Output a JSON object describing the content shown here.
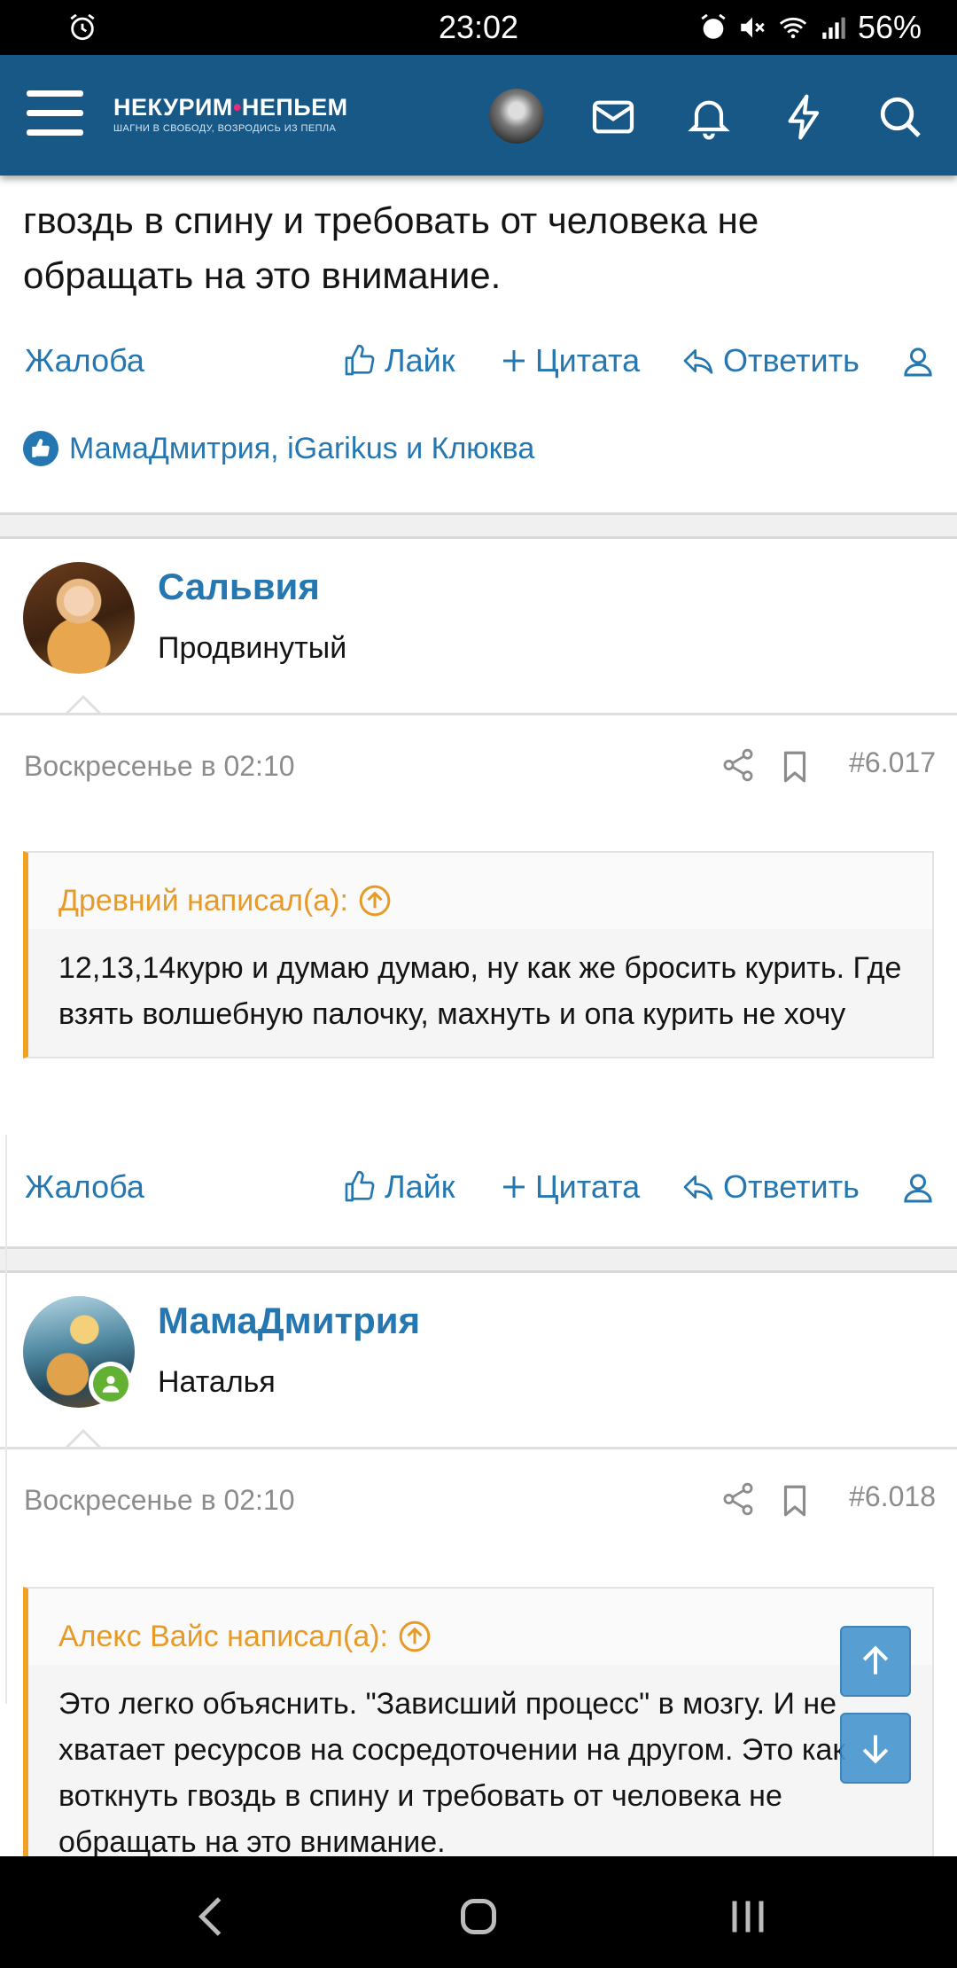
{
  "status_bar": {
    "time": "23:02",
    "battery": "56%"
  },
  "header": {
    "logo_line1_a": "НЕКУРИМ",
    "logo_line1_b": "НЕПЬЕМ",
    "logo_line2": "ШАГНИ В СВОБОДУ, ВОЗРОДИСЬ ИЗ ПЕПЛА"
  },
  "prev_post": {
    "text": "гвоздь в спину и требовать от человека не обращать на это внимание.",
    "likes_text": "МамаДмитрия, iGarikus и Клюква"
  },
  "actions": {
    "report": "Жалоба",
    "like": "Лайк",
    "quote": "Цитата",
    "reply": "Ответить"
  },
  "posts": [
    {
      "username": "Сальвия",
      "user_title": "Продвинутый",
      "date": "Воскресенье в 02:10",
      "number": "#6.017",
      "quote_author": "Древний написал(а):",
      "quote_text": "12,13,14курю и думаю думаю, ну как же бросить курить. Где взять волшебную палочку, махнуть и опа курить не хочу"
    },
    {
      "username": "МамаДмитрия",
      "user_title": "Наталья",
      "date": "Воскресенье в 02:10",
      "number": "#6.018",
      "quote_author": "Алекс Вайс написал(а):",
      "quote_text": "Это легко объяснить. \"Зависший процесс\" в мозгу. И не хватает ресурсов на сосредоточении на другом. Это как воткнуть гвоздь в спину и требовать от человека не обращать на это внимание."
    }
  ],
  "colors": {
    "header": "#185886",
    "link": "#2577b1",
    "quote_accent": "#f1a224",
    "online": "#63b132"
  }
}
